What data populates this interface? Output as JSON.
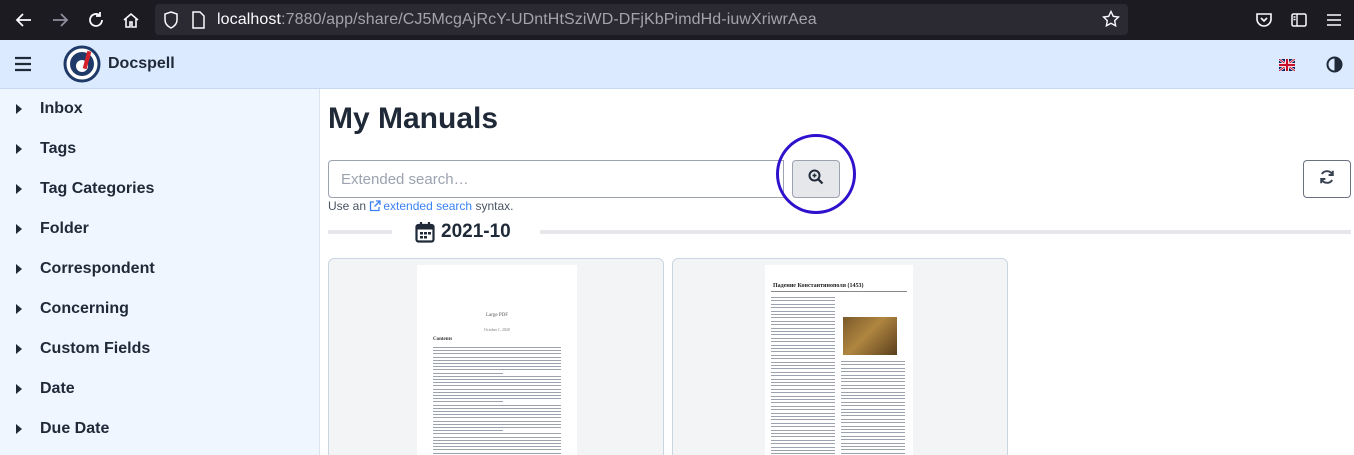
{
  "browser": {
    "url_host": "localhost",
    "url_rest": ":7880/app/share/CJ5McgAjRcY-UDntHtSziWD-DFjKbPimdHd-iuwXriwrAea"
  },
  "app": {
    "name": "Docspell",
    "accent": "#2d11cc"
  },
  "sidebar": {
    "items": [
      {
        "label": "Inbox"
      },
      {
        "label": "Tags"
      },
      {
        "label": "Tag Categories"
      },
      {
        "label": "Folder"
      },
      {
        "label": "Correspondent"
      },
      {
        "label": "Concerning"
      },
      {
        "label": "Custom Fields"
      },
      {
        "label": "Date"
      },
      {
        "label": "Due Date"
      }
    ]
  },
  "main": {
    "title": "My Manuals",
    "search": {
      "placeholder": "Extended search…",
      "value": ""
    },
    "hint": {
      "prefix": "Use an",
      "link": "extended search",
      "suffix": "syntax."
    },
    "group": {
      "label": "2021-10"
    },
    "cards": [
      {
        "doc_title": "Large PDF",
        "doc_date": "October 1, 2020",
        "heading": "Contents"
      },
      {
        "doc_title": "Падение Константинополя (1453)"
      }
    ]
  }
}
